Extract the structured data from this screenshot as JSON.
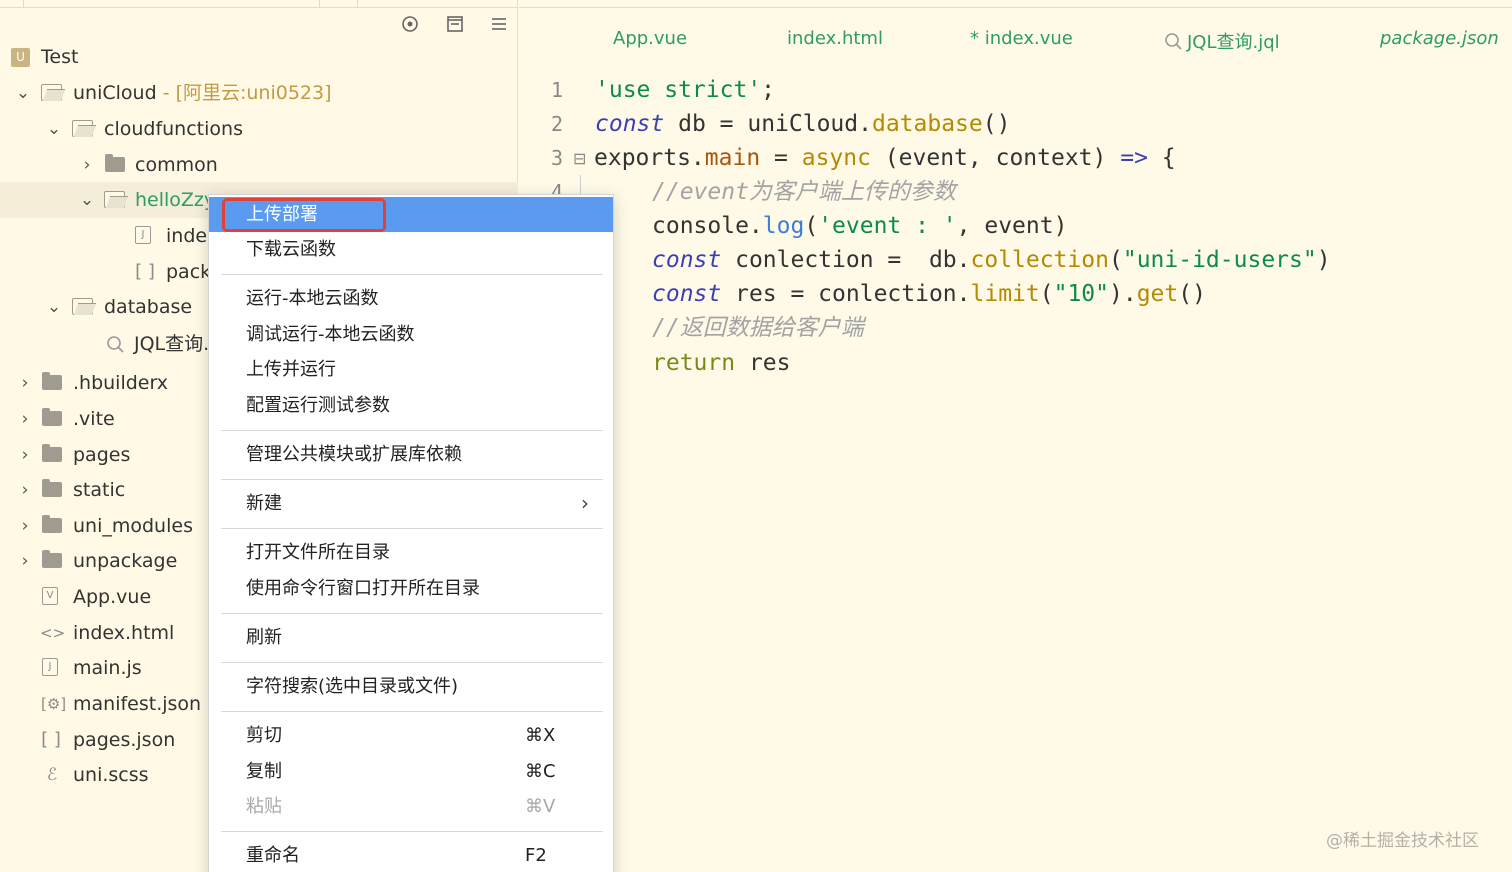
{
  "sidebar": {
    "toolbar": [
      "locate-icon",
      "collapse-icon",
      "menu-icon"
    ],
    "tree": [
      {
        "label": "Test",
        "sub": "",
        "icon": "project-icon"
      },
      {
        "label": "uniCloud",
        "sub": " - [阿里云:uni0523]",
        "icon": "folder-open-icon",
        "chevron": "v"
      },
      {
        "label": "cloudfunctions",
        "sub": "",
        "icon": "folder-open-icon",
        "chevron": "v"
      },
      {
        "label": "common",
        "sub": "",
        "icon": "folder-icon",
        "chevron": ">"
      },
      {
        "label": "helloZzy",
        "sub": "",
        "icon": "folder-open-icon",
        "chevron": "v",
        "selected": true
      },
      {
        "label": "inde",
        "sub": "",
        "icon": "js-file-icon"
      },
      {
        "label": "pack",
        "sub": "",
        "icon": "json-file-icon"
      },
      {
        "label": "database",
        "sub": "",
        "icon": "folder-open-icon",
        "chevron": "v"
      },
      {
        "label": "JQL查询.",
        "sub": "",
        "icon": "jql-file-icon"
      },
      {
        "label": ".hbuilderx",
        "sub": "",
        "icon": "folder-icon",
        "chevron": ">"
      },
      {
        "label": ".vite",
        "sub": "",
        "icon": "folder-icon",
        "chevron": ">"
      },
      {
        "label": "pages",
        "sub": "",
        "icon": "folder-icon",
        "chevron": ">"
      },
      {
        "label": "static",
        "sub": "",
        "icon": "folder-icon",
        "chevron": ">"
      },
      {
        "label": "uni_modules",
        "sub": "",
        "icon": "folder-icon",
        "chevron": ">"
      },
      {
        "label": "unpackage",
        "sub": "",
        "icon": "folder-icon",
        "chevron": ">"
      },
      {
        "label": "App.vue",
        "sub": "",
        "icon": "vue-file-icon"
      },
      {
        "label": "index.html",
        "sub": "",
        "icon": "html-file-icon"
      },
      {
        "label": "main.js",
        "sub": "",
        "icon": "js-file-icon"
      },
      {
        "label": "manifest.json",
        "sub": "",
        "icon": "manifest-file-icon"
      },
      {
        "label": "pages.json",
        "sub": "",
        "icon": "json-file-icon"
      },
      {
        "label": "uni.scss",
        "sub": "",
        "icon": "scss-file-icon"
      }
    ]
  },
  "editor": {
    "tabs": [
      {
        "label": "App.vue",
        "italic": false
      },
      {
        "label": "index.html",
        "italic": false
      },
      {
        "label": "* index.vue",
        "italic": false
      },
      {
        "label": "JQL查询.jql",
        "italic": false,
        "icon": "jql-icon"
      },
      {
        "label": "package.json",
        "italic": true
      }
    ],
    "line_numbers": [
      "1",
      "2",
      "3",
      "4"
    ],
    "fold_marker": "⊟",
    "code": {
      "l1": {
        "str": "'use strict'",
        "end": ";"
      },
      "l2": {
        "kw": "const",
        "a": " db = ",
        "b": "uniCloud.",
        "fn": "database",
        "c": "()"
      },
      "l3": {
        "a": "exports.",
        "prop": "main",
        "b": " = ",
        "kw": "async",
        "c": " (event, context) ",
        "arrow": "=>",
        "d": " {"
      },
      "l4": {
        "cm": "//event为客户端上传的参数"
      },
      "l5": {
        "a": "console.",
        "fn": "log",
        "b": "(",
        "str": "'event : '",
        "c": ", event)"
      },
      "l6": {
        "kw": "const",
        "a": " conlection =  db.",
        "fn": "collection",
        "b": "(",
        "str": "\"uni-id-users\"",
        "c": ")"
      },
      "l7": {
        "kw": "const",
        "a": " res = conlection.",
        "fn": "limit",
        "b": "(",
        "str": "\"10\"",
        "c": ").",
        "fn2": "get",
        "d": "()"
      },
      "l8": {
        "cm": "//返回数据给客户端"
      },
      "l9": {
        "kw": "return",
        "a": " res"
      },
      "l10": {
        "a": ";"
      }
    }
  },
  "context_menu": {
    "items": [
      {
        "label": "上传部署",
        "highlighted": true
      },
      {
        "label": "下载云函数"
      },
      {
        "label": "运行-本地云函数"
      },
      {
        "label": "调试运行-本地云函数"
      },
      {
        "label": "上传并运行"
      },
      {
        "label": "配置运行测试参数"
      },
      {
        "label": "管理公共模块或扩展库依赖"
      },
      {
        "label": "新建",
        "submenu": "›"
      },
      {
        "label": "打开文件所在目录"
      },
      {
        "label": "使用命令行窗口打开所在目录"
      },
      {
        "label": "刷新"
      },
      {
        "label": "字符搜索(选中目录或文件)"
      },
      {
        "label": "剪切",
        "shortcut": "⌘X"
      },
      {
        "label": "复制",
        "shortcut": "⌘C"
      },
      {
        "label": "粘贴",
        "shortcut": "⌘V",
        "disabled": true
      },
      {
        "label": "重命名",
        "shortcut": "F2"
      }
    ]
  },
  "watermark": "@稀土掘金技术社区",
  "colors": {
    "background": "#fffae8",
    "menu_highlight": "#5a9bef",
    "annotation_box": "#e0423a",
    "tab_text": "#2e9c64"
  }
}
